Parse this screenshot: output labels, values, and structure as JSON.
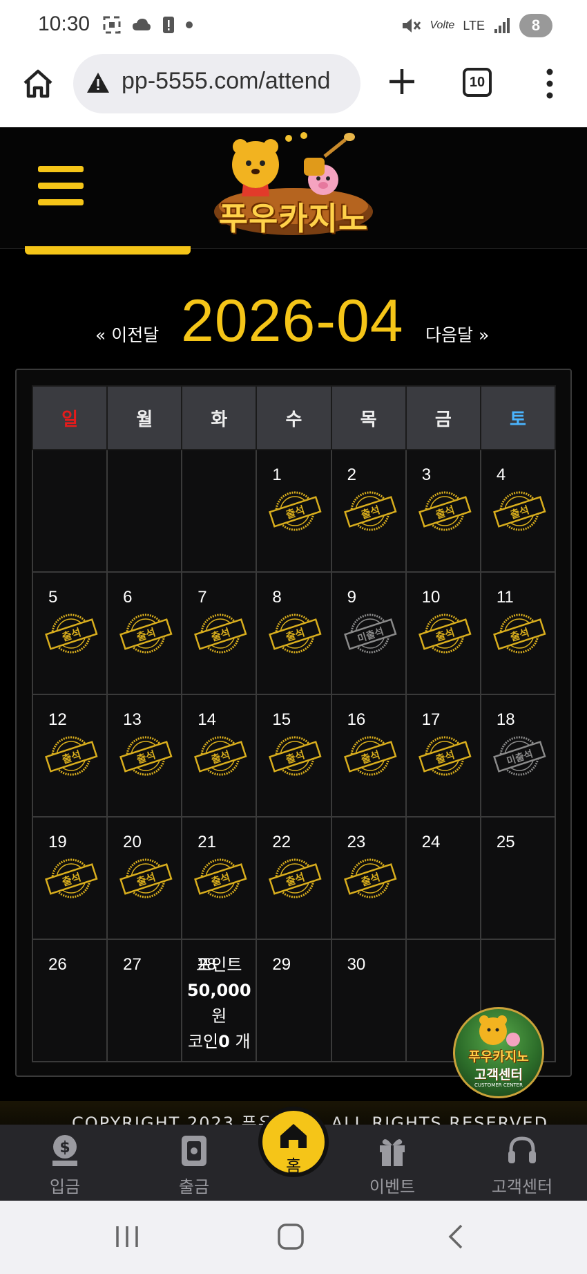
{
  "status_bar": {
    "time": "10:30",
    "network": "LTE",
    "volte": "Volte",
    "battery": "8"
  },
  "browser": {
    "url": "pp-5555.com/attend",
    "tab_count": "10"
  },
  "site": {
    "logo_text": "푸우카지노"
  },
  "month_nav": {
    "prev_label": "« 이전달",
    "current_month": "2026-04",
    "next_label": "다음달 »"
  },
  "calendar": {
    "weekdays": [
      "일",
      "월",
      "화",
      "수",
      "목",
      "금",
      "토"
    ],
    "stamp_attended": "출석",
    "stamp_missed": "미출석",
    "weeks": [
      [
        {
          "day": ""
        },
        {
          "day": ""
        },
        {
          "day": ""
        },
        {
          "day": "1",
          "status": "attended"
        },
        {
          "day": "2",
          "status": "attended"
        },
        {
          "day": "3",
          "status": "attended"
        },
        {
          "day": "4",
          "status": "attended"
        }
      ],
      [
        {
          "day": "5",
          "status": "attended"
        },
        {
          "day": "6",
          "status": "attended"
        },
        {
          "day": "7",
          "status": "attended"
        },
        {
          "day": "8",
          "status": "attended"
        },
        {
          "day": "9",
          "status": "missed"
        },
        {
          "day": "10",
          "status": "attended"
        },
        {
          "day": "11",
          "status": "attended"
        }
      ],
      [
        {
          "day": "12",
          "status": "attended"
        },
        {
          "day": "13",
          "status": "attended"
        },
        {
          "day": "14",
          "status": "attended"
        },
        {
          "day": "15",
          "status": "attended"
        },
        {
          "day": "16",
          "status": "attended"
        },
        {
          "day": "17",
          "status": "attended"
        },
        {
          "day": "18",
          "status": "missed"
        }
      ],
      [
        {
          "day": "19",
          "status": "attended"
        },
        {
          "day": "20",
          "status": "attended"
        },
        {
          "day": "21",
          "status": "attended"
        },
        {
          "day": "22",
          "status": "attended"
        },
        {
          "day": "23",
          "status": "attended"
        },
        {
          "day": "24"
        },
        {
          "day": "25"
        }
      ],
      [
        {
          "day": "26"
        },
        {
          "day": "27"
        },
        {
          "day": "28"
        },
        {
          "day": "29"
        },
        {
          "day": "30"
        },
        {
          "day": ""
        },
        {
          "day": ""
        }
      ]
    ],
    "today_points": {
      "label": "포인트",
      "amount": "50,000",
      "unit": "원",
      "coin_label": "코인",
      "coin_count": "0",
      "coin_unit": "개"
    }
  },
  "cs_badge": {
    "title": "푸우카지노",
    "subtitle": "고객센터",
    "caption": "CUSTOMER CENTER"
  },
  "copyright_text": "COPYRIGHT 2023 푸우카지노 ALL RIGHTS RESERVED",
  "bottom_nav": {
    "deposit": "입금",
    "withdraw": "출금",
    "home": "홈",
    "event": "이벤트",
    "support": "고객센터"
  },
  "colors": {
    "accent": "#f5c518",
    "sunday": "#e41b1b",
    "saturday": "#4ab5ff",
    "stamp_gold": "#d9ae1d",
    "stamp_gray": "#8a8a8a"
  }
}
